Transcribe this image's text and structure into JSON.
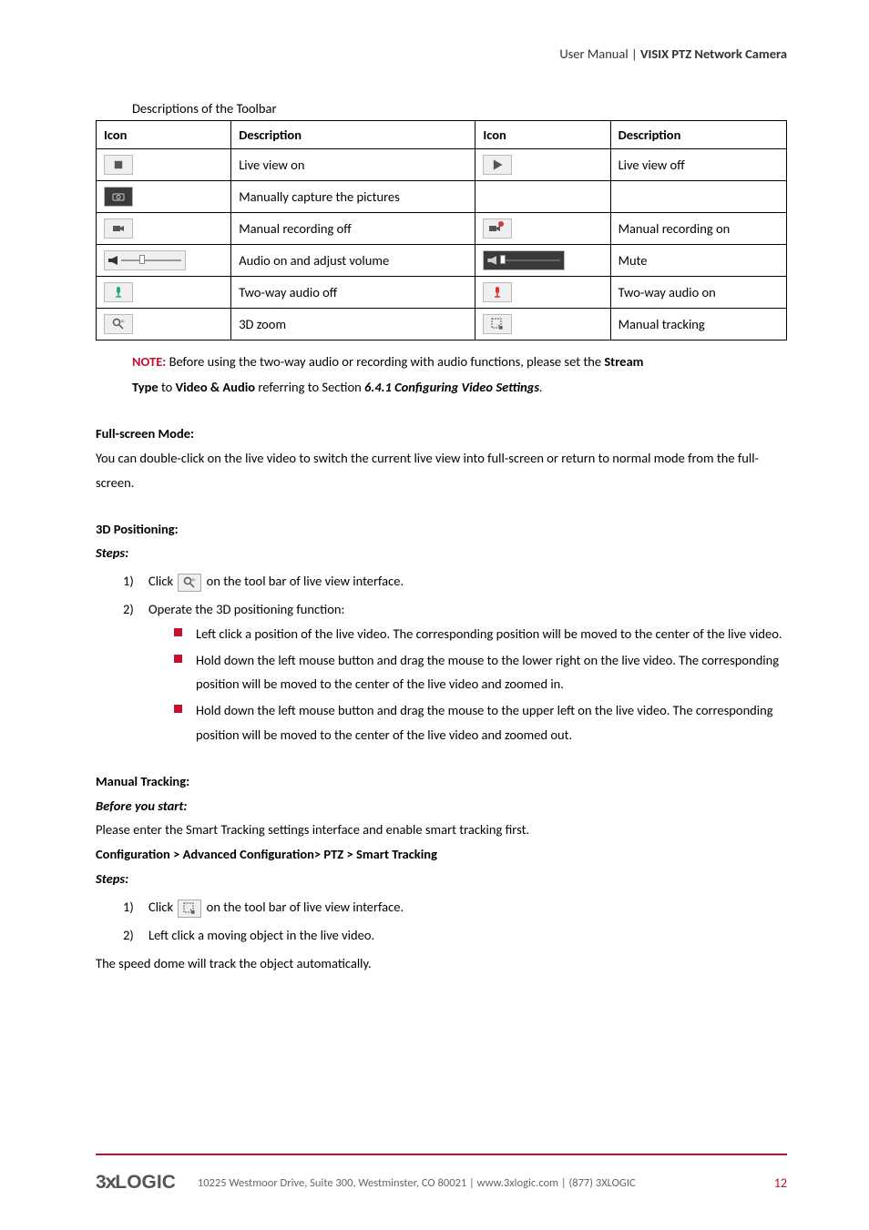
{
  "header": {
    "left": "User Manual",
    "separator": " | ",
    "right": "VISIX PTZ Network Camera"
  },
  "table_caption": "Descriptions of the Toolbar",
  "table": {
    "head": [
      "Icon",
      "Description",
      "Icon",
      "Description"
    ],
    "rows": [
      {
        "d1": "Live view on",
        "d2": "Live view off"
      },
      {
        "d1": "Manually capture the pictures",
        "d2": ""
      },
      {
        "d1": "Manual recording off",
        "d2": "Manual recording on"
      },
      {
        "d1": "Audio on and adjust volume",
        "d2": "Mute"
      },
      {
        "d1": "Two-way audio off",
        "d2": "Two-way audio on"
      },
      {
        "d1": "3D zoom",
        "d2": "Manual tracking"
      }
    ]
  },
  "note": {
    "label": "NOTE:",
    "line1a": " Before using the two-way audio or recording with audio functions, please set the ",
    "line1b": "Stream",
    "line2a": "Type",
    "line2b": " to ",
    "line2c": "Video & Audio",
    "line2d": " referring to Section ",
    "line2e": "6.4.1 Configuring Video Settings",
    "line2f": "."
  },
  "fullscreen": {
    "heading": "Full-screen Mode:",
    "body": "You can double-click on the live video to switch the current live view into full-screen or return to normal mode from the full-screen."
  },
  "pos3d": {
    "heading": "3D Positioning:",
    "steps_label": "Steps:",
    "step1a": "Click ",
    "step1b": " on the tool bar of live view interface.",
    "step2": "Operate the 3D positioning function:",
    "bullets": [
      "Left click a position of the live video. The corresponding position will be moved to the center of the live video.",
      "Hold down the left mouse button and drag the mouse to the lower right on the live video. The corresponding position will be moved to the center of the live video and zoomed in.",
      "Hold down the left mouse button and drag the mouse to the upper left on the live video. The corresponding position will be moved to the center of the live video and zoomed out."
    ]
  },
  "tracking": {
    "heading": "Manual Tracking:",
    "before": "Before you start:",
    "intro": "Please enter the Smart Tracking settings interface and enable smart tracking first.",
    "path": "Configuration > Advanced Configuration> PTZ > Smart Tracking",
    "steps_label": "Steps:",
    "step1a": "Click ",
    "step1b": " on the tool bar of live view interface.",
    "step2": "Left click a moving object in the live video.",
    "conclude": "The speed dome will track the object automatically."
  },
  "footer": {
    "logo": "3xLOGIC",
    "text": "10225 Westmoor Drive, Suite 300, Westminster, CO 80021 | www.3xlogic.com | (877) 3XLOGIC",
    "page": "12"
  }
}
